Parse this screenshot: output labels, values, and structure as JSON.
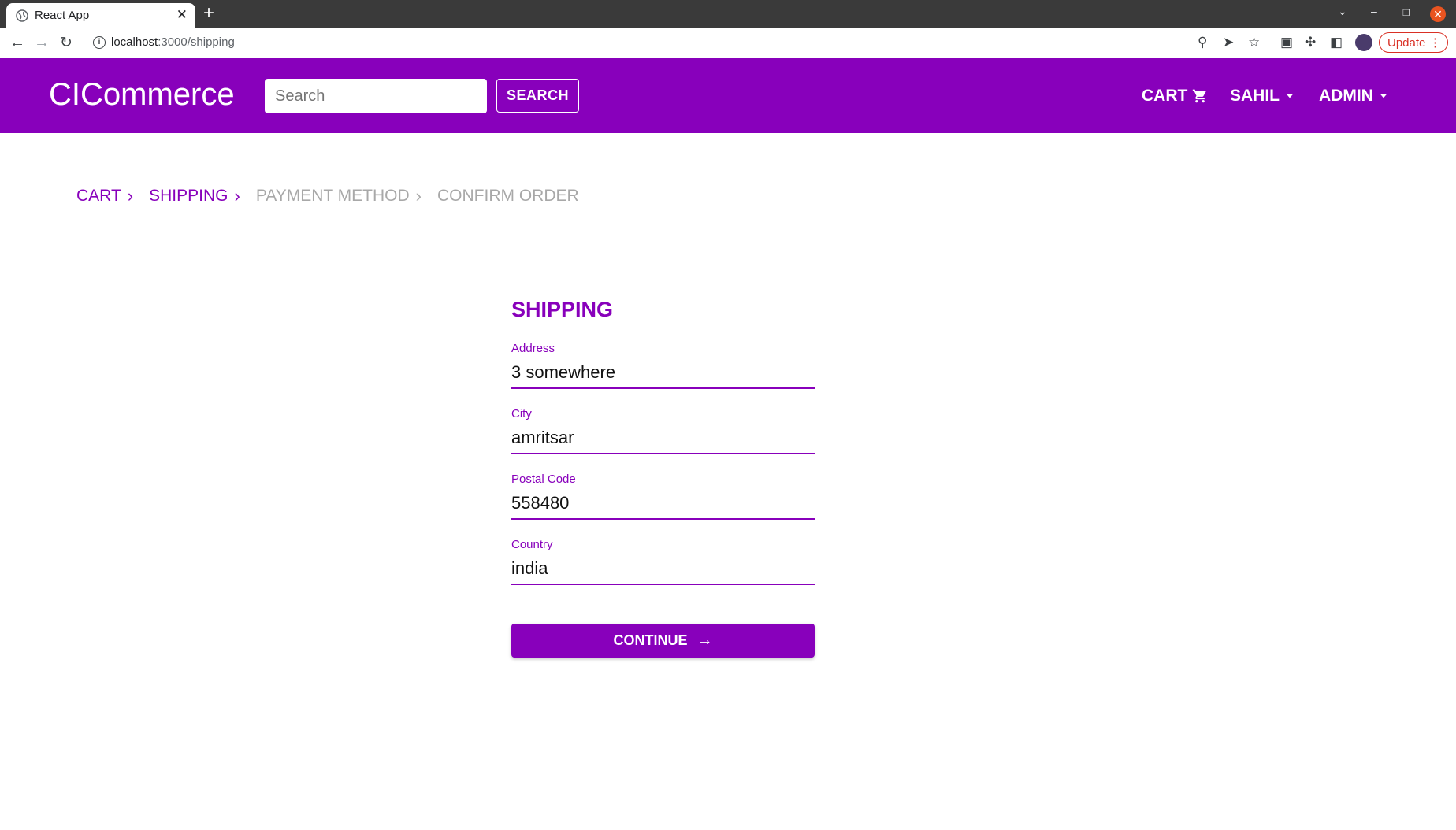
{
  "browser": {
    "tab_title": "React App",
    "url_host": "localhost",
    "url_path": ":3000/shipping",
    "update_label": "Update"
  },
  "header": {
    "brand": "CICommerce",
    "search_placeholder": "Search",
    "search_button": "SEARCH",
    "nav": {
      "cart": "CART",
      "user": "SAHIL",
      "admin": "ADMIN"
    }
  },
  "steps": [
    {
      "label": "CART",
      "state": "active"
    },
    {
      "label": "SHIPPING",
      "state": "active"
    },
    {
      "label": "PAYMENT METHOD",
      "state": "inactive"
    },
    {
      "label": "CONFIRM ORDER",
      "state": "inactive"
    }
  ],
  "form": {
    "title": "SHIPPING",
    "fields": [
      {
        "label": "Address",
        "value": "3 somewhere"
      },
      {
        "label": "City",
        "value": "amritsar"
      },
      {
        "label": "Postal Code",
        "value": "558480"
      },
      {
        "label": "Country",
        "value": "india"
      }
    ],
    "continue_label": "CONTINUE"
  },
  "colors": {
    "brand_purple": "#8800bb",
    "inactive_step": "#a8a8a8"
  }
}
